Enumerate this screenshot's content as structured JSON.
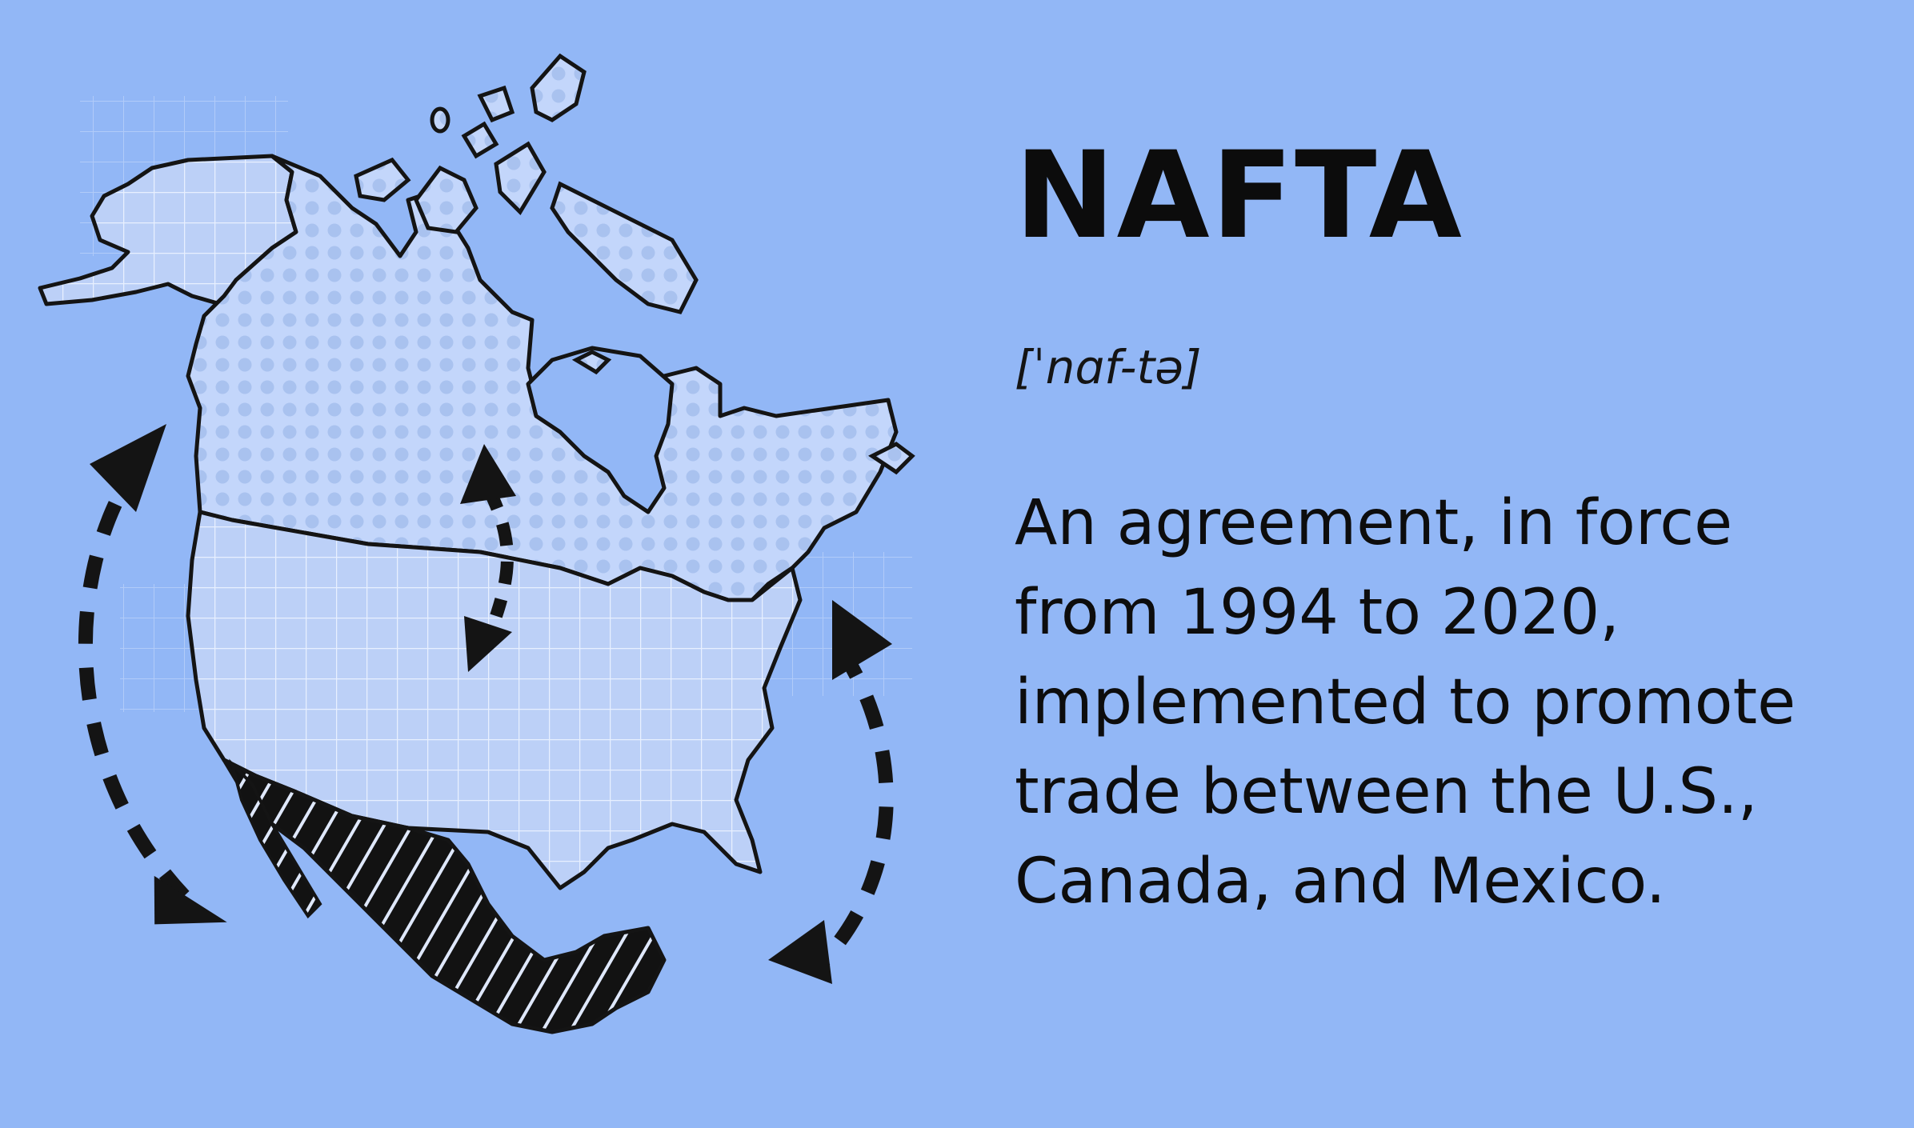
{
  "term": "NAFTA",
  "pronunciation": "[ˈnɑf-tə]",
  "definition": "An agreement, in force from 1994 to 2020, implemented to promote trade between the U.S., Canada, and Mexico.",
  "colors": {
    "background": "#92b7f6",
    "canada_fill": "#c3d6fb",
    "us_fill": "#bdd1f8",
    "mexico_fill": "#111111",
    "outline": "#141414",
    "arrows": "#141414"
  },
  "illustration": {
    "regions": [
      "canada",
      "united-states",
      "mexico"
    ],
    "icons": [
      "circular-arrow-icon",
      "double-arrow-icon"
    ]
  }
}
